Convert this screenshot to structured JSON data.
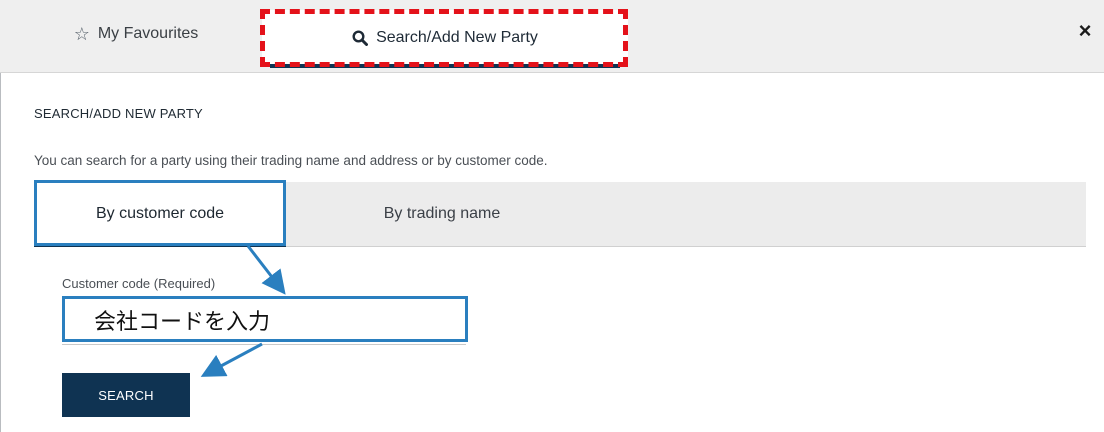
{
  "tabs": {
    "favourites_label": "My Favourites",
    "search_label": "Search/Add New Party",
    "close_symbol": "×"
  },
  "icons": {
    "favourites": "star-outline-icon",
    "search": "magnifier-icon",
    "close": "close-icon"
  },
  "main": {
    "title": "SEARCH/ADD NEW PARTY",
    "intro": "You can search for a party using their trading name and address or by customer code."
  },
  "search_modes": {
    "items": [
      {
        "label": "By customer code",
        "active": true
      },
      {
        "label": "By trading name",
        "active": false
      }
    ]
  },
  "form": {
    "customer_code_label": "Customer code  (Required)",
    "customer_code_value": "会社コードを入力",
    "search_button": "SEARCH"
  },
  "colors": {
    "accent": "#0f3352",
    "annotation_red": "#e4121a",
    "annotation_blue": "#2a7fbf"
  }
}
